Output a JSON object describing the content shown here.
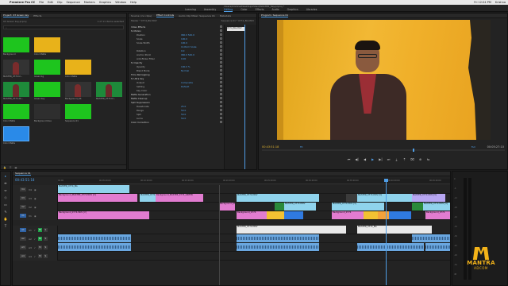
{
  "menubar": {
    "app": "Premiere Pro CC",
    "items": [
      "File",
      "Edit",
      "Clip",
      "Sequence",
      "Markers",
      "Graphics",
      "Window",
      "Help"
    ],
    "status_right": [
      "Fri 12:04 PM",
      "Krishna"
    ]
  },
  "window": {
    "path": "/Users/krishna/Desktop/Video/MASTER_Key.prproj *"
  },
  "workspaces": {
    "tabs": [
      "Learning",
      "Assembly",
      "Editing",
      "Color",
      "Effects",
      "Audio",
      "Graphics",
      "Libraries"
    ],
    "active": "Editing"
  },
  "project": {
    "tabs": [
      "Project: 03 Green key",
      "Effects"
    ],
    "item_count": "1 of 11 items selected",
    "search_placeholder": "03 Green key.prproj",
    "items": [
      {
        "name": "Background",
        "kind": "green"
      },
      {
        "name": "Color Matte",
        "kind": "yellow"
      },
      {
        "name": "MASTER_0774 bl...",
        "kind": "darkp"
      },
      {
        "name": "Green bg",
        "kind": "green"
      },
      {
        "name": "Color Matte",
        "kind": "yellow"
      },
      {
        "name": "MASTER_0774 Ab...",
        "kind": "greenp"
      },
      {
        "name": "Green Key",
        "kind": "green"
      },
      {
        "name": "Background_GS",
        "kind": "darkp"
      },
      {
        "name": "MASTER_0774 bl...",
        "kind": "greenp"
      },
      {
        "name": "Color Matte",
        "kind": "green"
      },
      {
        "name": "Background blue",
        "kind": "dark"
      },
      {
        "name": "Sequence 01",
        "kind": "green"
      },
      {
        "name": "Color Matte",
        "kind": "blue"
      }
    ]
  },
  "effect_controls": {
    "tabs": [
      "Source: (no clips)",
      "Effect Controls",
      "Audio Clip Mixer: Sequence 01",
      "Metadata"
    ],
    "active_tab": "Effect Controls",
    "source_line": "Master * 0774_BG.MOV",
    "sequence_line": "Sequence 01 * 0774_BG.MOV",
    "timeline_clip": "0774_BG.MOV",
    "rows": [
      {
        "label": "Video Effects",
        "value": "",
        "section": true
      },
      {
        "label": "fx Motion",
        "value": "",
        "section": true
      },
      {
        "label": "Position",
        "value": "960.0  540.0"
      },
      {
        "label": "Scale",
        "value": "100.0"
      },
      {
        "label": "Scale Width",
        "value": "100.0"
      },
      {
        "label": "",
        "value": "Uniform Scale"
      },
      {
        "label": "Rotation",
        "value": "0.0"
      },
      {
        "label": "Anchor Point",
        "value": "960.0  540.0"
      },
      {
        "label": "Anti-flicker Filter",
        "value": "0.00"
      },
      {
        "label": "fx Opacity",
        "value": "",
        "section": true
      },
      {
        "label": "Opacity",
        "value": "100.0 %"
      },
      {
        "label": "Blend Mode",
        "value": "Normal"
      },
      {
        "label": "Time Remapping",
        "value": "",
        "section": true
      },
      {
        "label": "fx Ultra Key",
        "value": "",
        "section": true
      },
      {
        "label": "Output",
        "value": "Composite"
      },
      {
        "label": "Setting",
        "value": "Default"
      },
      {
        "label": "Key Color",
        "value": ""
      },
      {
        "label": "Matte Generation",
        "value": "",
        "section": true
      },
      {
        "label": "Matte Cleanup",
        "value": "",
        "section": true
      },
      {
        "label": "Spill Suppression",
        "value": "",
        "section": true
      },
      {
        "label": "Desaturate",
        "value": "25.0"
      },
      {
        "label": "Range",
        "value": "50.0"
      },
      {
        "label": "Spill",
        "value": "50.0"
      },
      {
        "label": "Luma",
        "value": "50.0"
      },
      {
        "label": "Color Correction",
        "value": "",
        "section": true
      }
    ]
  },
  "program": {
    "title": "Program: Sequence 01",
    "timecode_current": "00:43:51:18",
    "timecode_duration": "00:05:27:10",
    "fit": "Fit",
    "quality": "Full",
    "transport": [
      "⏮",
      "◀|",
      "◀",
      "▶",
      "▶|",
      "⏭",
      "⤓",
      "⤒",
      "⌧",
      "⊕",
      "⇆"
    ]
  },
  "tools": [
    "▸",
    "⇹",
    "⇔",
    "◇",
    "▭",
    "✎",
    "✋",
    "T"
  ],
  "timeline": {
    "title": "Sequence 01",
    "timecode": "00:43:51:18",
    "ruler": [
      "00:00",
      "00:05:00:00",
      "00:10:00:00",
      "00:15:00:00",
      "00:20:00:00",
      "00:25:00:00",
      "00:30:00:00",
      "00:35:00:00",
      "00:40:00:00",
      "00:45:00:00"
    ],
    "tracks": [
      {
        "name": "V4",
        "type": "video",
        "target": false
      },
      {
        "name": "V3",
        "type": "video",
        "target": false
      },
      {
        "name": "V2",
        "type": "video",
        "target": false
      },
      {
        "name": "V1",
        "type": "video",
        "target": true
      },
      {
        "name": "A1",
        "type": "audio",
        "target": true
      },
      {
        "name": "A2",
        "type": "audio",
        "target": false
      },
      {
        "name": "A3",
        "type": "audio",
        "target": false
      },
      {
        "name": "A4",
        "type": "audio",
        "target": false
      }
    ],
    "clips": [
      {
        "track": 0,
        "label": "MASTER_0774_BG",
        "color": "cyan"
      },
      {
        "track": 1,
        "label": "Background_MASTER_0774.MOV [V]",
        "color": "pink"
      },
      {
        "track": 1,
        "label": "MASTER_0774.MOV [V]",
        "color": "cyan"
      },
      {
        "track": 1,
        "label": "Background_MASTER_0774_GREEN",
        "color": "pink"
      },
      {
        "track": 1,
        "label": "MASTER_0774.MOV",
        "color": "cyan"
      },
      {
        "track": 1,
        "label": "",
        "color": "dthumb"
      },
      {
        "track": 1,
        "label": "MASTER_0774.MOV [V]",
        "color": "cyan"
      },
      {
        "track": 1,
        "label": "MASTER_0774.MOV [V]",
        "color": "violet"
      },
      {
        "track": 2,
        "label": "Background_MASTER_0774_BG",
        "color": "pink"
      },
      {
        "track": 2,
        "label": "",
        "color": "gthumb"
      },
      {
        "track": 2,
        "label": "MASTER_0774.MOV",
        "color": "cyan"
      },
      {
        "track": 2,
        "label": "MASTER_0774.MOV [V]",
        "color": "cyan"
      },
      {
        "track": 2,
        "label": "",
        "color": "gthumb"
      },
      {
        "track": 2,
        "label": "MASTER_0774.MOV [V]",
        "color": "cyan"
      },
      {
        "track": 3,
        "label": "Background_0774.MOV [V]",
        "color": "pink"
      },
      {
        "track": 3,
        "label": "Background_0774",
        "color": "pink"
      },
      {
        "track": 3,
        "label": "",
        "color": "yellow"
      },
      {
        "track": 3,
        "label": "",
        "color": "blue"
      },
      {
        "track": 3,
        "label": "Background_0774",
        "color": "pink"
      },
      {
        "track": 3,
        "label": "",
        "color": "yellow"
      },
      {
        "track": 3,
        "label": "",
        "color": "orange"
      },
      {
        "track": 3,
        "label": "",
        "color": "blue"
      },
      {
        "track": 3,
        "label": "Background_0774",
        "color": "pink"
      },
      {
        "track": 4,
        "label": "MASTER_0774.MOV",
        "color": "white"
      },
      {
        "track": 4,
        "label": "MASTER_0774_BG",
        "color": "white"
      },
      {
        "track": 5,
        "label": "",
        "color": "audio"
      },
      {
        "track": 5,
        "label": "",
        "color": "audio"
      },
      {
        "track": 5,
        "label": "",
        "color": "audio"
      },
      {
        "track": 6,
        "label": "",
        "color": "audio"
      },
      {
        "track": 6,
        "label": "",
        "color": "audio"
      },
      {
        "track": 6,
        "label": "",
        "color": "audio"
      },
      {
        "track": 6,
        "label": "",
        "color": "audio"
      },
      {
        "track": 6,
        "label": "",
        "color": "audio"
      }
    ]
  },
  "meters": {
    "db_labels": [
      "0",
      "-6",
      "-12",
      "-18",
      "-24",
      "-30",
      "-36",
      "-42",
      "-48",
      "-54",
      "dB"
    ]
  },
  "logo": {
    "word": "MANTRA",
    "sub": "ADCOM"
  },
  "colors": {
    "accent": "#4f9ee6",
    "timecode": "#e0b431",
    "logo": "#f3b319",
    "panel": "#232323"
  }
}
